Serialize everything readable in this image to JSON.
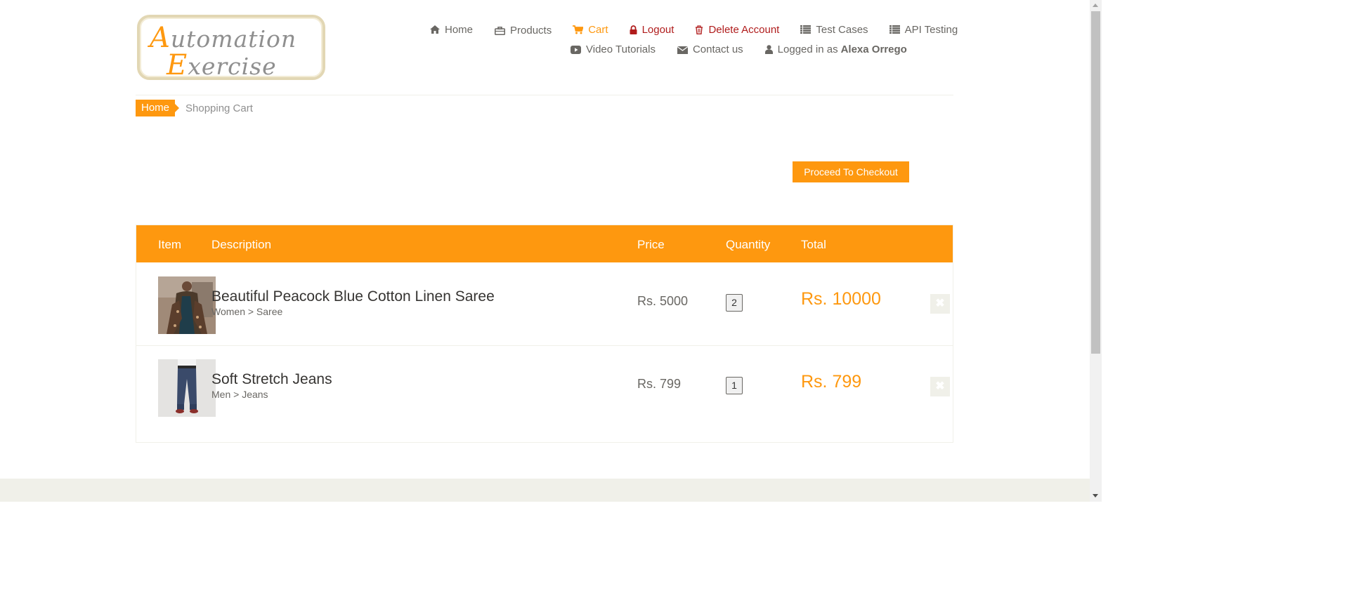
{
  "brand": {
    "logo_line1_cap": "A",
    "logo_line1_rest": "utomation",
    "logo_line2_cap": "E",
    "logo_line2_rest": "xercise"
  },
  "nav": {
    "home": "Home",
    "products": "Products",
    "cart": "Cart",
    "logout": "Logout",
    "delete_account": "Delete Account",
    "test_cases": "Test Cases",
    "api_testing": "API Testing",
    "video_tutorials": "Video Tutorials",
    "contact_us": "Contact us",
    "logged_in_prefix": "Logged in as",
    "logged_in_user": "Alexa Orrego"
  },
  "breadcrumb": {
    "home": "Home",
    "current": "Shopping Cart"
  },
  "checkout": {
    "button_label": "Proceed To Checkout"
  },
  "cart": {
    "headers": {
      "item": "Item",
      "description": "Description",
      "price": "Price",
      "quantity": "Quantity",
      "total": "Total"
    },
    "items": [
      {
        "name": "Beautiful Peacock Blue Cotton Linen Saree",
        "category": "Women > Saree",
        "price": "Rs. 5000",
        "quantity": "2",
        "total": "Rs. 10000"
      },
      {
        "name": "Soft Stretch Jeans",
        "category": "Men > Jeans",
        "price": "Rs. 799",
        "quantity": "1",
        "total": "Rs. 799"
      }
    ]
  },
  "icons": {
    "home": "home-icon",
    "products": "briefcase-icon",
    "cart": "shopping-cart-icon",
    "logout": "lock-icon",
    "delete_account": "trash-icon",
    "test_cases": "list-icon",
    "api_testing": "list-icon",
    "video_tutorials": "youtube-play-icon",
    "contact_us": "envelope-icon",
    "logged_in": "user-icon",
    "remove_item": "close-icon"
  },
  "colors": {
    "accent": "#fe980f",
    "text": "#696763",
    "danger": "#b01c1c",
    "muted_bg": "#f0f0e9"
  }
}
